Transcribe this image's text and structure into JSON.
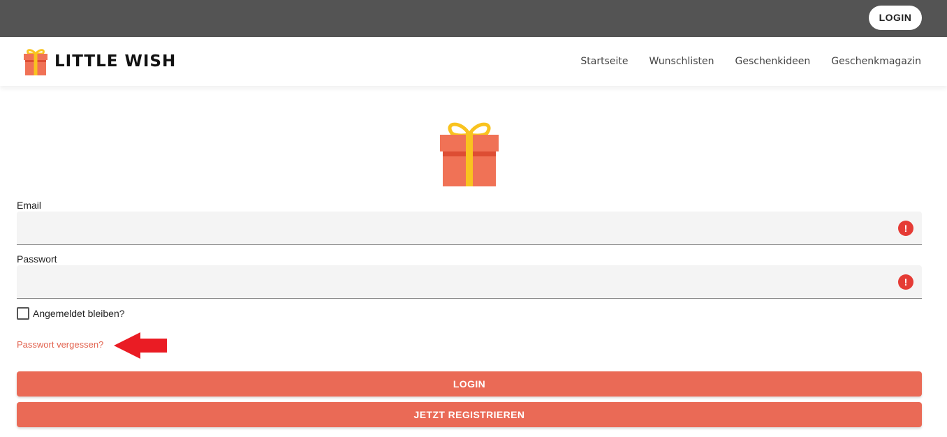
{
  "topbar": {
    "login_label": "LOGIN"
  },
  "header": {
    "brand": "LITTLE WISH",
    "nav": [
      {
        "label": "Startseite"
      },
      {
        "label": "Wunschlisten"
      },
      {
        "label": "Geschenkideen"
      },
      {
        "label": "Geschenkmagazin"
      }
    ]
  },
  "form": {
    "email": {
      "label": "Email",
      "value": "",
      "error_icon": "!"
    },
    "password": {
      "label": "Passwort",
      "value": "",
      "error_icon": "!"
    },
    "remember": {
      "label": "Angemeldet bleiben?",
      "checked": false
    },
    "forgot_link": "Passwort vergessen?",
    "login_button": "LOGIN",
    "register_button": "JETZT REGISTRIEREN"
  },
  "icons": {
    "brand": "gift-icon",
    "hero": "gift-icon",
    "annotation": "red-arrow-left-icon",
    "field_error": "exclamation-circle-icon"
  },
  "colors": {
    "topbar": "#545454",
    "accent": "#ea6a56",
    "link": "#e26450",
    "error": "#e53b35",
    "gift_body": "#f07256",
    "gift_ribbon": "#f9c31f",
    "annotation_arrow": "#ea1c24"
  }
}
